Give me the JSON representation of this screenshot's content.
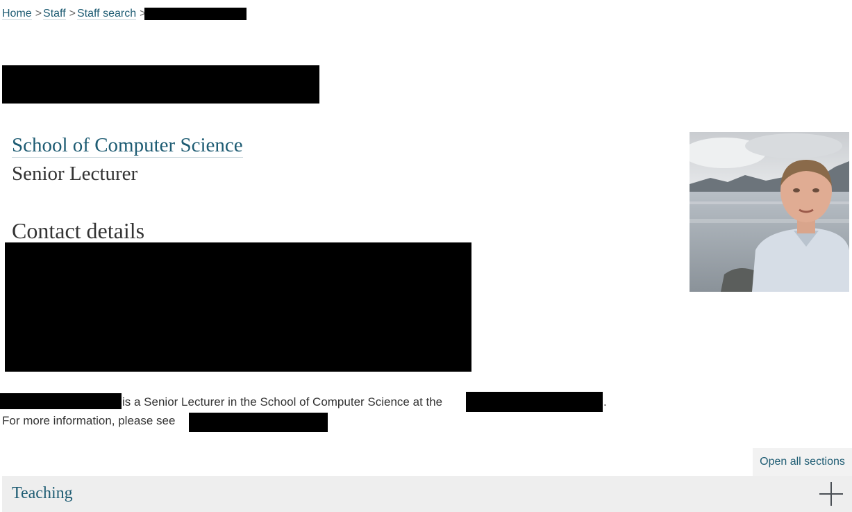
{
  "breadcrumb": {
    "items": [
      "Home",
      "Staff",
      "Staff search"
    ],
    "separator": ">"
  },
  "profile": {
    "school_link": "School of Computer Science",
    "job_title": "Senior Lecturer",
    "contact_heading": "Contact details"
  },
  "bio": {
    "line1": "is a Senior Lecturer in the School of Computer Science at the",
    "line1_end": ".",
    "line2": "For more information, please see"
  },
  "actions": {
    "open_all": "Open all sections"
  },
  "sections": [
    {
      "label": "Teaching",
      "icon": "plus-icon"
    }
  ],
  "colors": {
    "link": "#1e5c73",
    "accordion_bg": "#eeeeee",
    "redaction": "#000000"
  }
}
